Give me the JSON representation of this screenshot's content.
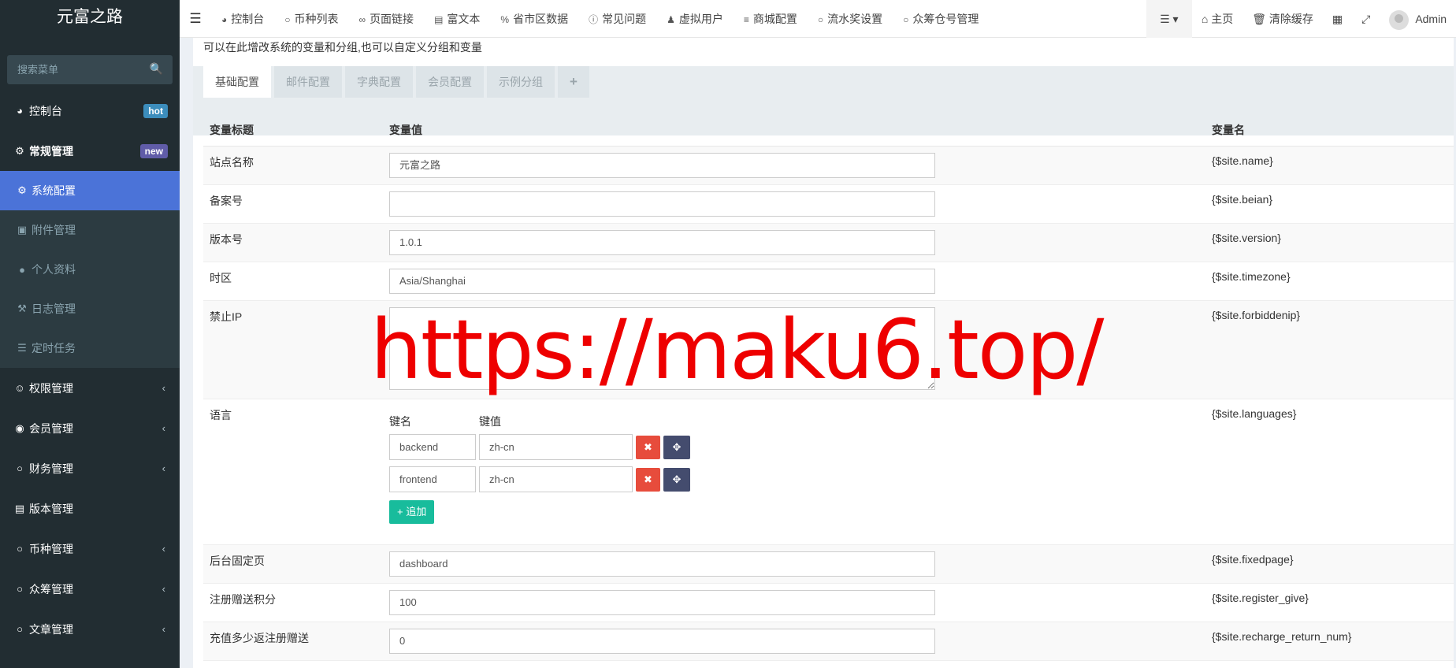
{
  "sidebar": {
    "brand": "元富之路",
    "search_placeholder": "搜索菜单",
    "items": [
      {
        "label": "控制台",
        "badge": "hot"
      },
      {
        "label": "常规管理",
        "badge": "new"
      }
    ],
    "sub_items": [
      {
        "label": "系统配置"
      },
      {
        "label": "附件管理"
      },
      {
        "label": "个人资料"
      },
      {
        "label": "日志管理"
      },
      {
        "label": "定时任务"
      }
    ],
    "items_after": [
      {
        "label": "权限管理"
      },
      {
        "label": "会员管理"
      },
      {
        "label": "财务管理"
      },
      {
        "label": "版本管理"
      },
      {
        "label": "币种管理"
      },
      {
        "label": "众筹管理"
      },
      {
        "label": "文章管理"
      }
    ]
  },
  "topnav": {
    "tabs": [
      "控制台",
      "币种列表",
      "页面链接",
      "富文本",
      "省市区数据",
      "常见问题",
      "虚拟用户",
      "商城配置",
      "流水奖设置",
      "众筹仓号管理"
    ],
    "home": "主页",
    "clear_cache": "清除缓存",
    "user": "Admin"
  },
  "content": {
    "tip": "可以在此增改系统的变量和分组,也可以自定义分组和变量",
    "tabs": [
      "基础配置",
      "邮件配置",
      "字典配置",
      "会员配置",
      "示例分组"
    ],
    "headers": {
      "title": "变量标题",
      "value": "变量值",
      "name": "变量名"
    },
    "rows": {
      "name": {
        "title": "站点名称",
        "value": "元富之路",
        "var": "{$site.name}"
      },
      "beian": {
        "title": "备案号",
        "value": "",
        "var": "{$site.beian}"
      },
      "version": {
        "title": "版本号",
        "value": "1.0.1",
        "var": "{$site.version}"
      },
      "timezone": {
        "title": "时区",
        "value": "Asia/Shanghai",
        "var": "{$site.timezone}"
      },
      "forbiddenip": {
        "title": "禁止IP",
        "value": "",
        "var": "{$site.forbiddenip}"
      },
      "languages": {
        "title": "语言",
        "key_label": "键名",
        "value_label": "键值",
        "pairs": [
          {
            "key": "backend",
            "value": "zh-cn"
          },
          {
            "key": "frontend",
            "value": "zh-cn"
          }
        ],
        "add_label": "追加",
        "var": "{$site.languages}"
      },
      "fixedpage": {
        "title": "后台固定页",
        "value": "dashboard",
        "var": "{$site.fixedpage}"
      },
      "register_give": {
        "title": "注册赠送积分",
        "value": "100",
        "var": "{$site.register_give}"
      },
      "recharge": {
        "title": "充值多少返注册赠送",
        "value": "0",
        "var": "{$site.recharge_return_num}"
      }
    }
  },
  "watermark": "https://maku6.top/"
}
